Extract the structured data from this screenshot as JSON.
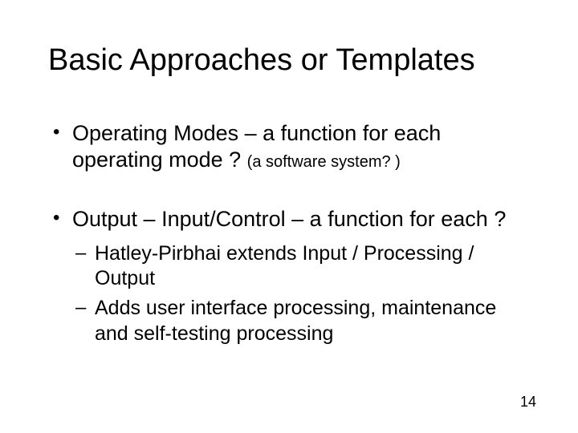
{
  "title": "Basic Approaches or Templates",
  "bullets": [
    {
      "text": "Operating Modes – a function for each operating mode ? ",
      "paren": "(a software system? )",
      "sub": []
    },
    {
      "text": "Output – Input/Control – a function for each ?",
      "sub": [
        {
          "text": "Hatley-Pirbhai extends Input / Processing / Output"
        },
        {
          "text": "Adds user interface processing, maintenance and self-testing processing"
        }
      ]
    }
  ],
  "page_number": "14"
}
